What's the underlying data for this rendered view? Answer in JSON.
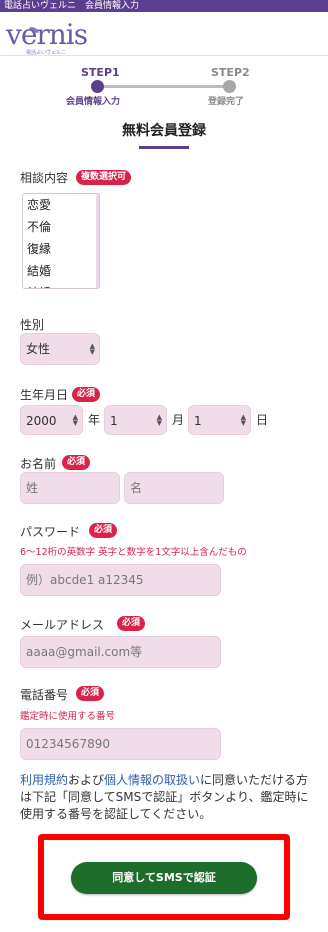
{
  "header": {
    "title": "電話占いヴェルニ　会員情報入力",
    "logo_text": "vernis",
    "logo_sub": "電話占いヴェルニ"
  },
  "steps": {
    "step1": {
      "label": "STEP1",
      "sub": "会員情報入力",
      "state": "active"
    },
    "step2": {
      "label": "STEP2",
      "sub": "登録完了",
      "state": "inactive"
    }
  },
  "page_title": "無料会員登録",
  "consultation": {
    "label": "相談内容",
    "badge": "複数選択可",
    "options": [
      "恋愛",
      "不倫",
      "復縁",
      "結婚",
      "結婚"
    ]
  },
  "gender": {
    "label": "性別",
    "value": "女性"
  },
  "birthday": {
    "label": "生年月日",
    "badge": "必須",
    "year": "2000",
    "year_unit": "年",
    "month": "1",
    "month_unit": "月",
    "day": "1",
    "day_unit": "日"
  },
  "name": {
    "label": "お名前",
    "badge": "必須",
    "last_placeholder": "姓",
    "first_placeholder": "名"
  },
  "password": {
    "label": "パスワード",
    "badge": "必須",
    "note": "6～12桁の英数字 英字と数字を1文字以上含んだもの",
    "placeholder": "例）abcde1 a12345"
  },
  "email": {
    "label": "メールアドレス",
    "badge": "必須",
    "placeholder": "aaaa@gmail.com等"
  },
  "phone": {
    "label": "電話番号",
    "badge": "必須",
    "note": "鑑定時に使用する番号",
    "placeholder": "01234567890"
  },
  "consent": {
    "terms_link": "利用規約",
    "and": "および",
    "privacy_link": "個人情報の取扱い",
    "rest": "に同意いただける方は下記「同意してSMSで認証」ボタンより、鑑定時に使用する番号を認証してください。"
  },
  "submit_label": "同意してSMSで認証",
  "colors": {
    "brand": "#5b3f8e",
    "required_badge": "#d9234a",
    "field_bg": "#f0dde9",
    "button": "#1f6d2b",
    "highlight": "#ff0000",
    "link": "#2d5fa8"
  }
}
